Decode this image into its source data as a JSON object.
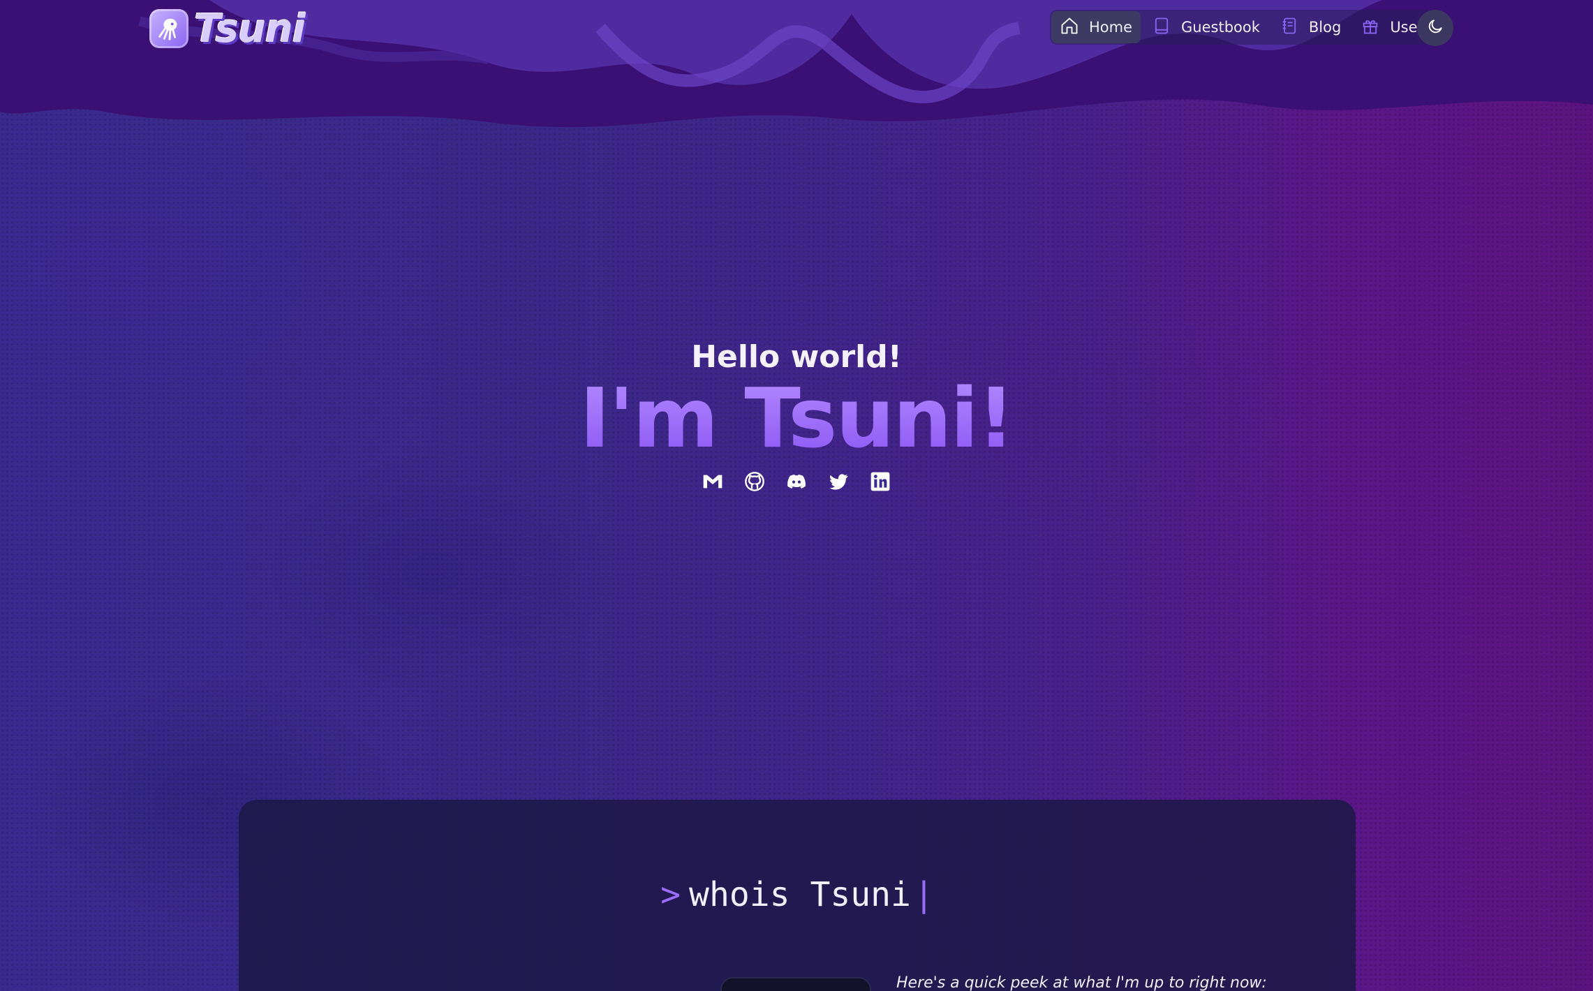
{
  "brand": {
    "name": "Tsuni",
    "logo_icon": "squid-logo-icon"
  },
  "nav": {
    "items": [
      {
        "label": "Home",
        "icon": "home-icon",
        "active": true
      },
      {
        "label": "Guestbook",
        "icon": "book-icon",
        "active": false
      },
      {
        "label": "Blog",
        "icon": "notebook-icon",
        "active": false
      },
      {
        "label": "Uses",
        "icon": "gift-icon",
        "active": false
      }
    ],
    "theme_toggle_icon": "moon-icon"
  },
  "hero": {
    "greeting": "Hello world!",
    "title": "I'm Tsuni!",
    "socials": [
      "gmail-icon",
      "github-icon",
      "discord-icon",
      "twitter-icon",
      "linkedin-icon"
    ]
  },
  "about": {
    "prompt": ">",
    "command": "whois Tsuni",
    "cursor": "|",
    "peek_text": "Here's a quick peek at what I'm up to right now:"
  },
  "colors": {
    "accent": "#9a6cf7",
    "background": "#34227a",
    "card": "#1e1848",
    "nav_active": "#3c3a63"
  }
}
